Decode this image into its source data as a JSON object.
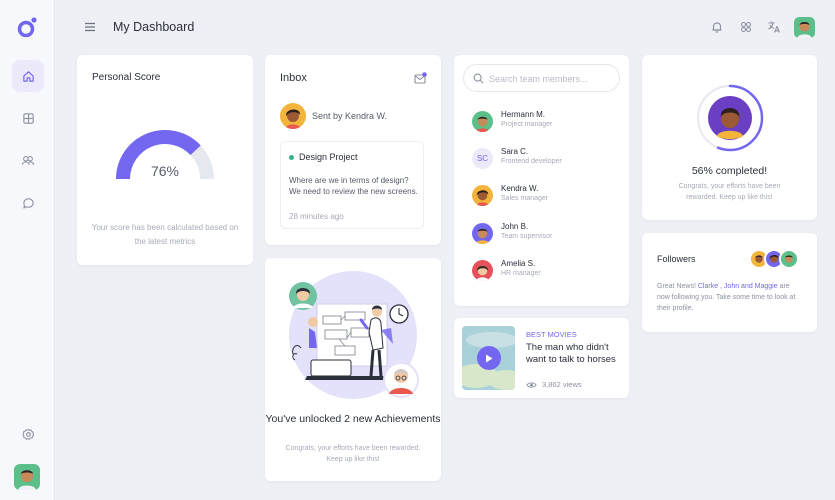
{
  "colors": {
    "accent": "#7367f0",
    "accent_light": "#ece9fb",
    "green": "#34b28a",
    "bg": "#eef0f6"
  },
  "header": {
    "title": "My Dashboard",
    "icons": [
      "menu-icon",
      "bell-icon",
      "apps-icon",
      "translate-icon"
    ]
  },
  "sidebar": {
    "items": [
      "home-icon",
      "grid-icon",
      "users-icon",
      "chat-icon"
    ],
    "settings": "settings-icon"
  },
  "score": {
    "title": "Personal Score",
    "value": 0.76,
    "percent_label": "76%",
    "note": "Your score has been calculated based on the latest metrics"
  },
  "inbox": {
    "title": "Inbox",
    "sender": "Sent by Kendra W.",
    "subject": "Design Project",
    "body": "Where are we in terms of design? We need to review the new screens.",
    "time": "28 minutes ago"
  },
  "achievements": {
    "title": "You've unlocked 2 new Achievements",
    "note": "Congrats, your efforts have been rewarded. Keep up like this!"
  },
  "team": {
    "search_placeholder": "Search team members...",
    "members": [
      {
        "name": "Hermann M.",
        "role": "Project manager",
        "initials": ""
      },
      {
        "name": "Sara C.",
        "role": "Frontend developer",
        "initials": "SC"
      },
      {
        "name": "Kendra W.",
        "role": "Sales manager",
        "initials": ""
      },
      {
        "name": "John B.",
        "role": "Team supervisor",
        "initials": ""
      },
      {
        "name": "Amelia S.",
        "role": "HR manager",
        "initials": ""
      }
    ]
  },
  "movie": {
    "tag": "BEST MOVIES",
    "title": "The man who didn't want to talk to horses",
    "views": "3,862 views"
  },
  "progress": {
    "value": 0.56,
    "label": "56% completed!",
    "note": "Congrats, your efforts have been rewarded. Keep up like this!"
  },
  "followers": {
    "title": "Followers",
    "prefix": "Great News! ",
    "highlight": "Clarke , John and Maggie",
    "suffix": " are now following you. Take some time to look at their profile."
  }
}
